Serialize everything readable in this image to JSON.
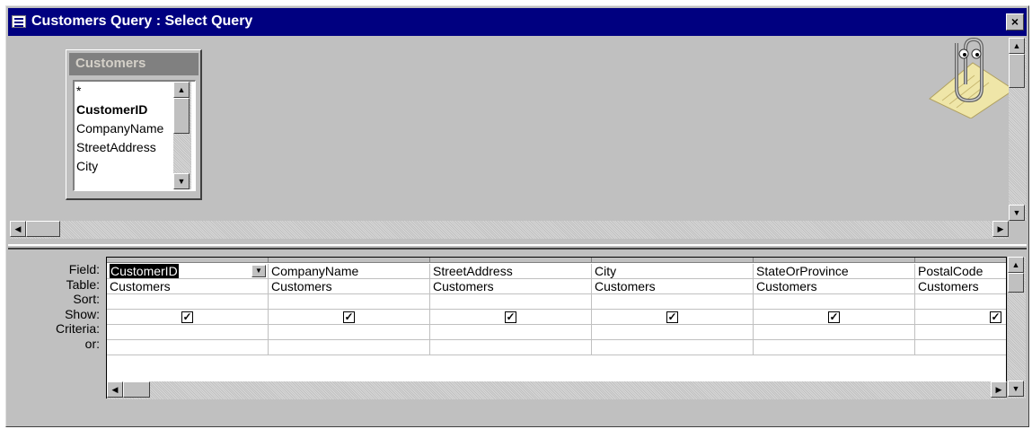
{
  "window": {
    "title": "Customers Query : Select Query",
    "close_label": "×"
  },
  "table_box": {
    "title": "Customers",
    "fields": [
      "*",
      "CustomerID",
      "CompanyName",
      "StreetAddress",
      "City"
    ]
  },
  "design_grid": {
    "row_labels": [
      "Field:",
      "Table:",
      "Sort:",
      "Show:",
      "Criteria:",
      "or:"
    ],
    "columns": [
      {
        "field": "CustomerID",
        "table": "Customers",
        "show": true
      },
      {
        "field": "CompanyName",
        "table": "Customers",
        "show": true
      },
      {
        "field": "StreetAddress",
        "table": "Customers",
        "show": true
      },
      {
        "field": "City",
        "table": "Customers",
        "show": true
      },
      {
        "field": "StateOrProvince",
        "table": "Customers",
        "show": true
      },
      {
        "field": "PostalCode",
        "table": "Customers",
        "show": true
      }
    ],
    "check_glyph": "✓"
  },
  "icons": {
    "system_menu": "query-window-icon",
    "assistant": "office-assistant-clippy-icon",
    "arrows": [
      "scroll-up-arrow-icon",
      "scroll-down-arrow-icon",
      "scroll-left-arrow-icon",
      "scroll-right-arrow-icon",
      "dropdown-arrow-icon"
    ]
  },
  "colors": {
    "titlebar": "#000080",
    "face": "#c0c0c0"
  }
}
